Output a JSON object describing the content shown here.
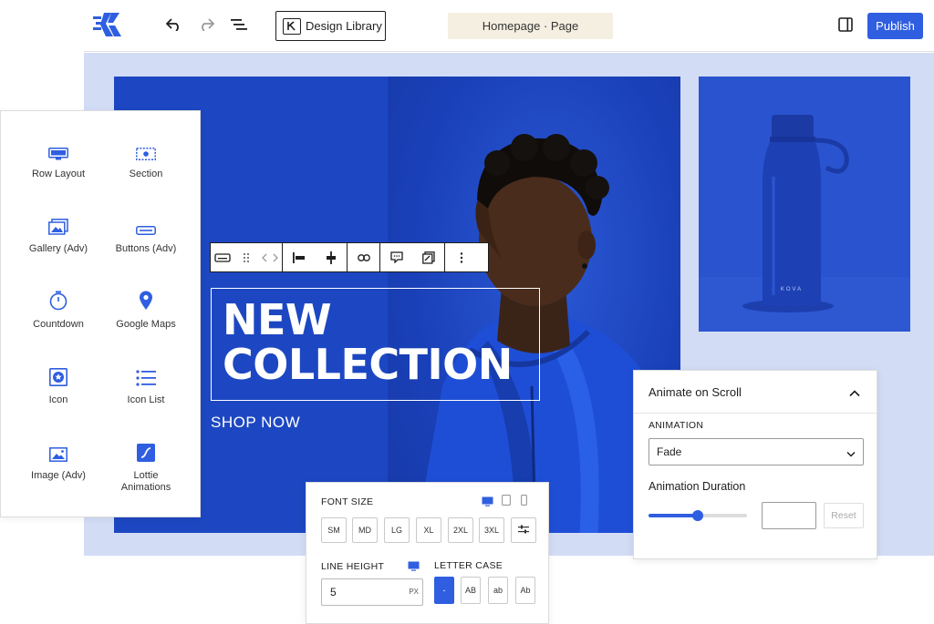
{
  "toolbar": {
    "design_library_label": "Design Library",
    "page_title": "Homepage · Page",
    "publish_label": "Publish"
  },
  "hero": {
    "headline_line1": "NEW",
    "headline_line2": "COLLECTION",
    "cta": "SHOP NOW",
    "bottle_brand": "KOVA"
  },
  "inserter": {
    "blocks": [
      {
        "label": "Row Layout",
        "icon": "row-layout-icon"
      },
      {
        "label": "Section",
        "icon": "section-icon"
      },
      {
        "label": "Gallery (Adv)",
        "icon": "gallery-icon"
      },
      {
        "label": "Buttons (Adv)",
        "icon": "buttons-icon"
      },
      {
        "label": "Countdown",
        "icon": "countdown-icon"
      },
      {
        "label": "Google Maps",
        "icon": "map-pin-icon"
      },
      {
        "label": "Icon",
        "icon": "star-icon"
      },
      {
        "label": "Icon List",
        "icon": "list-icon"
      },
      {
        "label": "Image (Adv)",
        "icon": "image-icon"
      },
      {
        "label": "Lottie Animations",
        "icon": "lottie-icon"
      }
    ]
  },
  "font_panel": {
    "font_size_label": "FONT SIZE",
    "sizes": [
      "SM",
      "MD",
      "LG",
      "XL",
      "2XL",
      "3XL"
    ],
    "line_height_label": "LINE HEIGHT",
    "line_height_value": "5",
    "line_height_unit": "PX",
    "letter_case_label": "LETTER CASE",
    "cases": [
      "-",
      "AB",
      "ab",
      "Ab"
    ]
  },
  "anim_panel": {
    "title": "Animate on Scroll",
    "animation_label": "ANIMATION",
    "animation_value": "Fade",
    "duration_label": "Animation Duration",
    "duration_slider_fraction": 0.5,
    "reset_label": "Reset"
  },
  "colors": {
    "accent": "#2f5ee0",
    "hero_blue": "#1d47c2",
    "canvas_bg": "#d2dcf5",
    "page_pill_bg": "#f4efe0"
  }
}
